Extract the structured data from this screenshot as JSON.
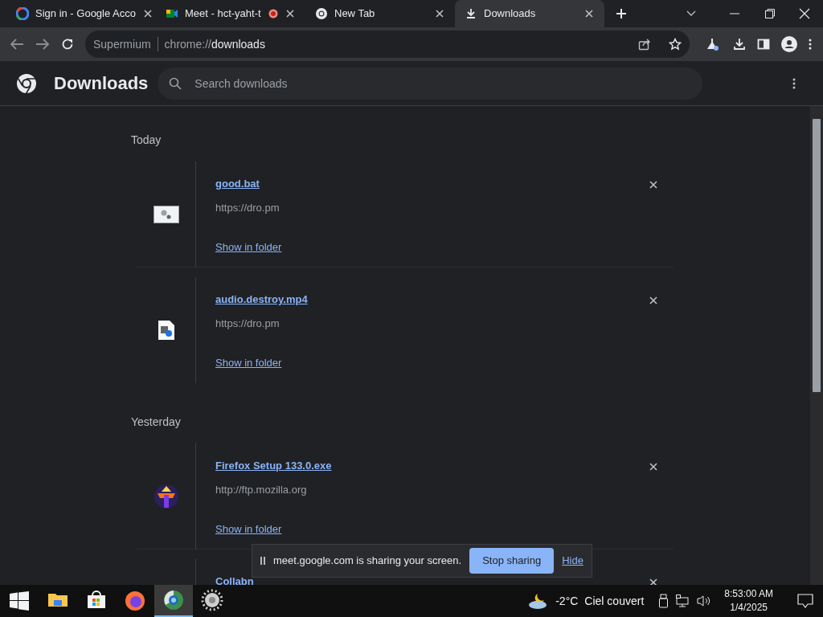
{
  "tabs": [
    {
      "title": "Sign in - Google Acco",
      "kind": "google",
      "recording": false,
      "selected": false
    },
    {
      "title": "Meet - hct-yaht-t",
      "kind": "meet",
      "recording": true,
      "selected": false
    },
    {
      "title": "New Tab",
      "kind": "chrome",
      "recording": false,
      "selected": false
    },
    {
      "title": "Downloads",
      "kind": "download",
      "recording": false,
      "selected": true
    }
  ],
  "address": {
    "site": "Supermium",
    "scheme": "chrome://",
    "path": "downloads"
  },
  "header": {
    "title": "Downloads",
    "search_placeholder": "Search downloads"
  },
  "groups": [
    {
      "label": "Today",
      "items": [
        {
          "name": "good.bat",
          "url": "https://dro.pm",
          "action": "Show in folder",
          "kind": "bat"
        },
        {
          "name": "audio.destroy.mp4",
          "url": "https://dro.pm",
          "action": "Show in folder",
          "kind": "media"
        }
      ]
    },
    {
      "label": "Yesterday",
      "items": [
        {
          "name": "Firefox Setup 133.0.exe",
          "url": "http://ftp.mozilla.org",
          "action": "Show in folder",
          "kind": "installer"
        },
        {
          "name": "Collabn",
          "kind": "partial"
        }
      ]
    }
  ],
  "share_bar": {
    "message": "meet.google.com is sharing your screen.",
    "stop": "Stop sharing",
    "hide": "Hide"
  },
  "taskbar": {
    "apps": [
      {
        "kind": "explorer",
        "selected": false
      },
      {
        "kind": "store",
        "selected": false
      },
      {
        "kind": "firefox",
        "selected": false
      },
      {
        "kind": "chromium",
        "selected": true
      },
      {
        "kind": "gear",
        "selected": false
      }
    ],
    "weather": {
      "temp": "-2°C",
      "condition": "Ciel couvert"
    },
    "time": "8:53:00 AM",
    "date": "1/4/2025"
  }
}
